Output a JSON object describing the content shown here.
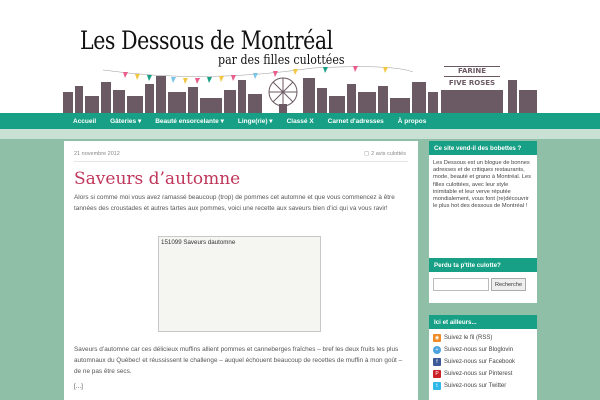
{
  "header": {
    "title": "Les Dessous de Montréal",
    "tagline": "par des filles culottées",
    "skyline_sign_top": "FARINE",
    "skyline_sign_bottom": "FIVE ROSES"
  },
  "nav": {
    "items": [
      {
        "label": "Accueil"
      },
      {
        "label": "Gâteries ▾"
      },
      {
        "label": "Beauté ensorcelante ▾"
      },
      {
        "label": "Linge(rie) ▾"
      },
      {
        "label": "Classé X"
      },
      {
        "label": "Carnet d'adresses"
      },
      {
        "label": "À propos"
      }
    ]
  },
  "post": {
    "date": "21 novembre 2012",
    "comments": "2 avis culottés",
    "title": "Saveurs d’automne",
    "intro": "Alors si comme moi vous avez ramassé beaucoup (trop) de pommes cet automne et que vous commencez à être tannées des croustades et autres tartes aux pommes, voici une recette aux saveurs bien d’ici qui va vous ravir!",
    "image_caption": "151099 Saveurs dautomne",
    "body": "Saveurs d’automne car ces délicieux muffins allient pommes et canneberges fraîches – bref les deux fruits les plus automnaux du Québec! et réussissent le challenge – auquel échouent beaucoup de recettes de muffin à mon goût – de ne pas être secs.",
    "read_more": "[...]"
  },
  "sidebar": {
    "about_title": "Ce site vend-il des bobettes ?",
    "about_text": "Les Dessous est un blogue de bonnes adresses et de critiques restaurants, mode, beauté et grano à Montréal. Les filles culottées, avec leur style inimitable et leur verve réputée mondialement, vous font (re)découvrir le plus hot des dessous de Montréal !",
    "search_title": "Perdu ta p'tite culotte?",
    "search_button": "Recherche",
    "links_title": "Ici et ailleurs...",
    "links": [
      {
        "label": "Suivez le fil (RSS)",
        "icon": "rss-icon",
        "color": "#f08a24"
      },
      {
        "label": "Suivez-nous sur Bloglovin",
        "icon": "bloglovin-icon",
        "color": "#4aa3df"
      },
      {
        "label": "Suivez-nous sur Facebook",
        "icon": "facebook-icon",
        "color": "#3b5998"
      },
      {
        "label": "Suivez-nous sur Pinterest",
        "icon": "pinterest-icon",
        "color": "#cb2027"
      },
      {
        "label": "Suivez-nous sur Twitter",
        "icon": "twitter-icon",
        "color": "#2fb8e8"
      }
    ]
  },
  "colors": {
    "accent": "#17a085",
    "background": "#8fbfa6",
    "title": "#c0365a"
  }
}
